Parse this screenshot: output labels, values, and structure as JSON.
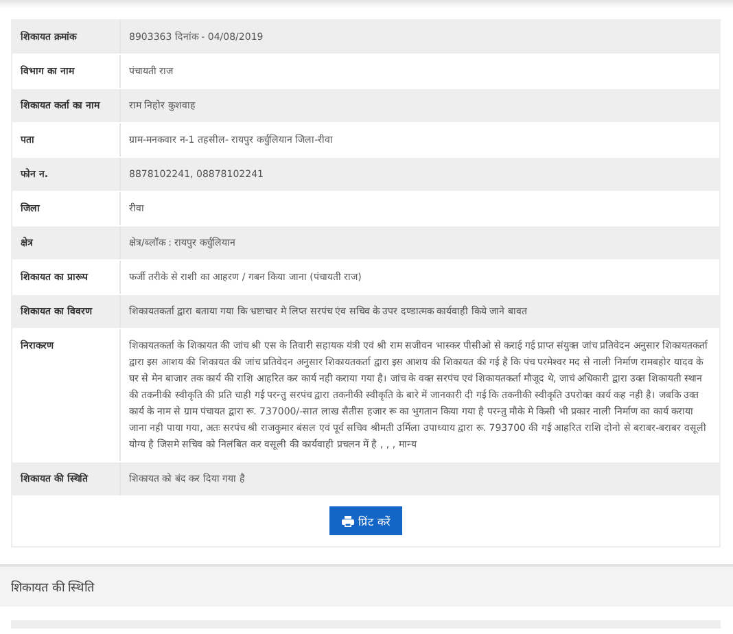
{
  "details": {
    "rows": [
      {
        "label": "शिकायत क्रमांक",
        "value": "8903363 दिनांक - 04/08/2019"
      },
      {
        "label": "विभाग का नाम",
        "value": "पंचायती राज"
      },
      {
        "label": "शिकायत कर्ता का नाम",
        "value": "राम निहोर कुशवाह"
      },
      {
        "label": "पता",
        "value": "ग्राम-मनकवार न-1 तहसील- रायपुर कर्चुलियान जिला-रीवा"
      },
      {
        "label": "फोन न.",
        "value": "8878102241, 08878102241"
      },
      {
        "label": "जिला",
        "value": "रीवा"
      },
      {
        "label": "क्षेत्र",
        "value": "क्षेत्र/ब्लॉक : रायपुर कर्चुलियान"
      },
      {
        "label": "शिकायत का प्रारूप",
        "value": "फर्जी तरीके से राशी का आहरण / गबन किया जाना (पंचायती राज)"
      },
      {
        "label": "शिकायत का विवरण",
        "value": "शिकायतकर्ता द्वारा बताया गया कि भ्रष्टाचार मे लिप्त सरपंच एंव सचिव के उपर दण्डात्मक कार्यवाही किये जाने बावत"
      },
      {
        "label": "निराकरण",
        "value": "शिकायतकर्ता के शिकायत की जांच श्री एस के तिवारी सहायक यंत्री एवं श्री राम सजीवन भास्कर पीसीओ से कराई गई प्राप्त संयुक्त जांच प्रतिवेदन अनुसार शिकायतकर्ता द्वारा इस आशय की शिकायत की जांच प्रतिवेदन अनुसार शिकायतकर्ता द्वारा इस आशय की शिकायत की गई है कि पंच परमेश्वर मद से नाली निर्माण रामबहोर यादव के घर से मेन बाजार तक कार्य की राशि आहरित कर कार्य नही कराया गया है। जांच के वक्त सरपंच एवं शिकायतकर्ता मौजूद थे, जाचं अधिकारी द्वारा उक्त शिकायती स्थान की तकनीकी स्वीकृति की प्रति चाही गई परन्तु सरपंच द्वारा तकनीकी स्वीकृति के बारे में जानकारी दी गई कि तकनीकी स्वीकृति उपरोक्त कार्य कह नही है। जबकि उक्त कार्य के नाम से ग्राम पंचायत द्वारा रू. 737000/-सात लाख सैतीस हजार रू का भुगतान किया गया है परन्तु मौके मे किसी भी प्रकार नाली निर्माण का कार्य कराया जाना नही पाया गया, अतः सरपंच श्री राजकुमार बंसल एवं पूर्व सचिव श्रीमती उर्मिला उपाध्याय द्वारा रू. 793700 की गई आहरित राशि दोनो से बराबर-बराबर वसूली योग्य है जिसमे सचिव को निलंबित कर वसूली की कार्यवाही प्रचलन में है , , , मान्य"
      },
      {
        "label": "शिकायत की स्थिति",
        "value": "शिकायत को बंद कर दिया गया है"
      }
    ],
    "print_button": "प्रिंट करें"
  },
  "status_section": {
    "title": "शिकायत की स्थिति"
  }
}
